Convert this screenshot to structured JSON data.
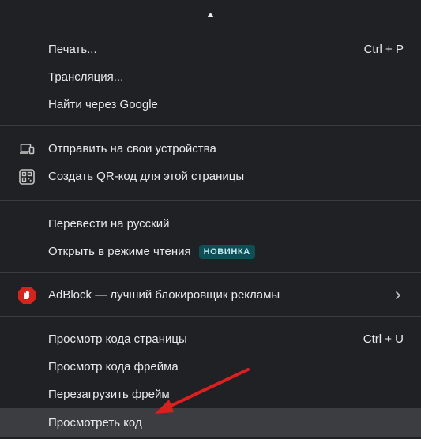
{
  "menu": {
    "scroll_up_icon": "triangle-up-icon",
    "print_label": "Печать...",
    "print_shortcut": "Ctrl + P",
    "cast_label": "Трансляция...",
    "search_google_label": "Найти через Google",
    "send_to_devices_label": "Отправить на свои устройства",
    "send_to_devices_icon": "devices-icon",
    "create_qr_label": "Создать QR-код для этой страницы",
    "create_qr_icon": "qr-code-icon",
    "translate_label": "Перевести на русский",
    "reading_mode_label": "Открыть в режиме чтения",
    "reading_mode_badge": "НОВИНКА",
    "adblock_label": "AdBlock — лучший блокировщик рекламы",
    "adblock_icon": "adblock-hand-icon",
    "view_source_label": "Просмотр кода страницы",
    "view_source_shortcut": "Ctrl + U",
    "view_frame_source_label": "Просмотр кода фрейма",
    "reload_frame_label": "Перезагрузить фрейм",
    "inspect_label": "Просмотреть код"
  },
  "colors": {
    "background": "#202124",
    "text": "#e8eaed",
    "highlight": "#3c3d40",
    "badge_bg": "#0e4e55",
    "badge_text": "#bfe9ef",
    "adblock_red": "#d9221a",
    "annotation_arrow": "#e01e1e"
  }
}
